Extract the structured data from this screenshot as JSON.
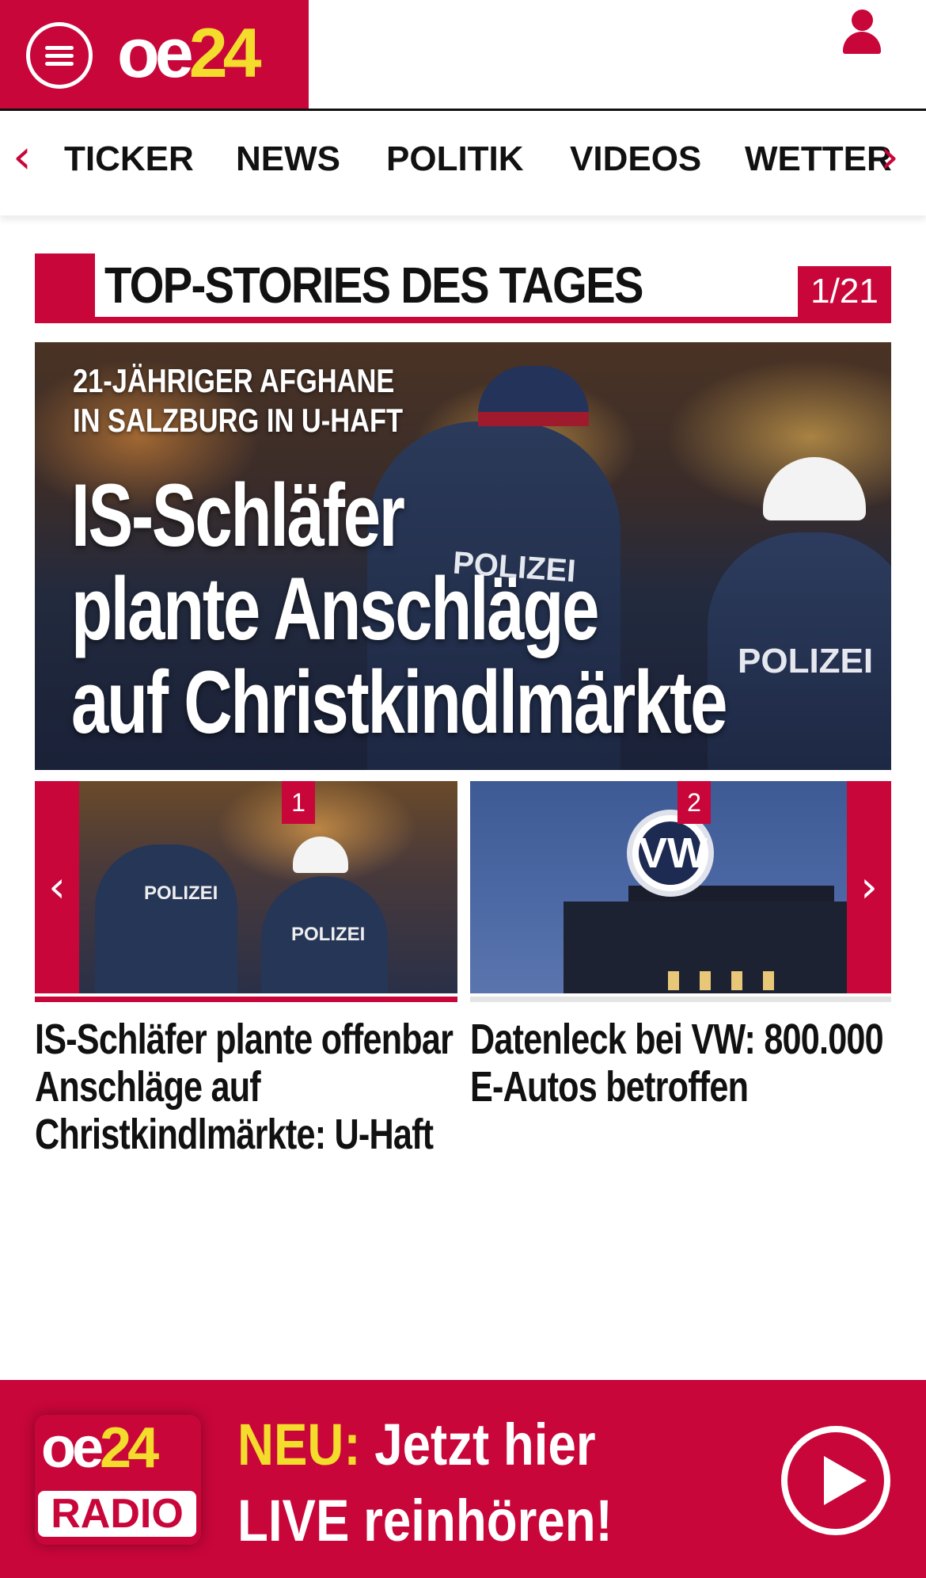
{
  "header": {
    "logo": {
      "part1": "oe",
      "part2": "24"
    },
    "menu_icon": "hamburger-icon",
    "user_icon": "user-icon",
    "colors": {
      "brand_red": "#c8063a",
      "brand_yellow": "#f3dc2c"
    }
  },
  "nav": {
    "prev_arrow": "‹",
    "next_arrow": "›",
    "items": [
      "TICKER",
      "NEWS",
      "POLITIK",
      "VIDEOS",
      "WETTER"
    ]
  },
  "section": {
    "title": "TOP-STORIES DES TAGES",
    "counter": "1/21"
  },
  "hero": {
    "kicker_line1": "21-JÄHRIGER AFGHANE",
    "kicker_line2": "IN SALZBURG IN U-HAFT",
    "headline_line1": "IS-Schläfer",
    "headline_line2": "plante Anschläge",
    "headline_line3": "auf Christkindlmärkte",
    "uniform_text": "POLIZEI"
  },
  "carousel": {
    "prev_arrow": "‹",
    "next_arrow": "›",
    "stories": [
      {
        "badge": "1",
        "title_line1": "IS-Schläfer plante offenbar",
        "title_line2": "Anschläge auf",
        "title_line3": "Christkindlmärkte: U-Haft",
        "uniform_text": "POLIZEI"
      },
      {
        "badge": "2",
        "title_line1": "Datenleck bei VW: 800.000",
        "title_line2": "E-Autos betroffen",
        "title_line3": "",
        "logo_text": "VW"
      }
    ]
  },
  "radio": {
    "logo_part1": "oe",
    "logo_part2": "24",
    "logo_radio": "RADIO",
    "neu": "NEU:",
    "line1_rest": " Jetzt hier",
    "line2": "LIVE reinhören!",
    "play_icon": "play-icon"
  }
}
